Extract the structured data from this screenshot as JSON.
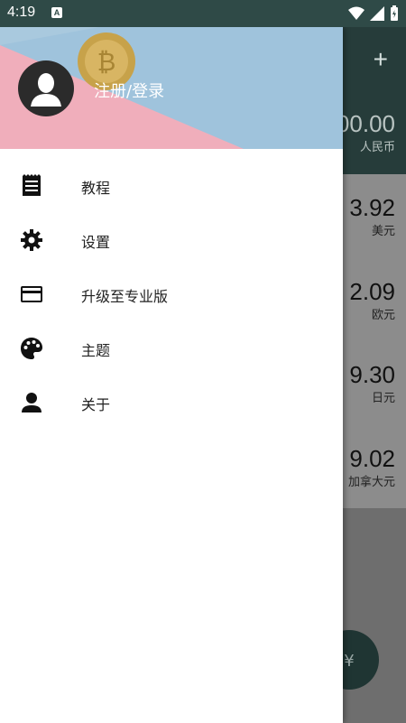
{
  "status_bar": {
    "time": "4:19",
    "notification_icon": "A"
  },
  "header": {
    "title": "注册/登录",
    "avatar_icon": "person-avatar-icon"
  },
  "menu": [
    {
      "label": "教程",
      "icon": "receipt-icon"
    },
    {
      "label": "设置",
      "icon": "gear-icon"
    },
    {
      "label": "升级至专业版",
      "icon": "credit-card-icon"
    },
    {
      "label": "主题",
      "icon": "palette-icon"
    },
    {
      "label": "关于",
      "icon": "person-icon"
    }
  ],
  "background_app": {
    "header_value": "00.00",
    "header_unit": "人民币",
    "rows": [
      {
        "value": "3.92",
        "unit": "美元"
      },
      {
        "value": "2.09",
        "unit": "欧元"
      },
      {
        "value": "9.30",
        "unit": "日元"
      },
      {
        "value": "9.02",
        "unit": "加拿大元"
      }
    ],
    "fab_label": "¥"
  },
  "colors": {
    "status_bar": "#2f4a47",
    "drawer_bg": "#ffffff",
    "icon": "#111111"
  }
}
